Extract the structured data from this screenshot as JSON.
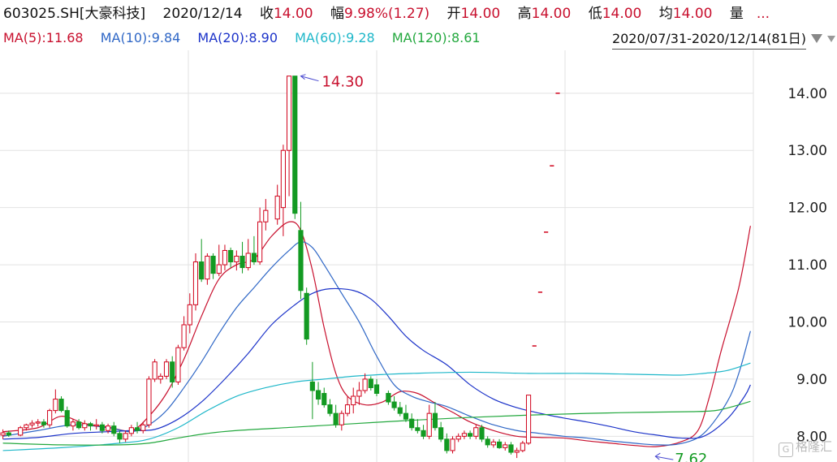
{
  "header": {
    "code_name": "603025.SH[大豪科技]",
    "date": "2020/12/14",
    "close_label": "收",
    "close_value": "14.00",
    "change_label": "幅",
    "change_value": "9.98%(1.27)",
    "open_label": "开",
    "open_value": "14.00",
    "high_label": "高",
    "high_value": "14.00",
    "low_label": "低",
    "low_value": "14.00",
    "avg_label": "均",
    "avg_value": "14.00",
    "volume_label": "量",
    "volume_value": "..."
  },
  "ma_legend": [
    {
      "label": "MA(5):11.68",
      "color": "#c8102e"
    },
    {
      "label": "MA(10):9.84",
      "color": "#2f67c6"
    },
    {
      "label": "MA(20):8.90",
      "color": "#1c33c9"
    },
    {
      "label": "MA(60):9.28",
      "color": "#1eb7c9"
    },
    {
      "label": "MA(120):8.61",
      "color": "#23a83e"
    }
  ],
  "range_text": "2020/07/31-2020/12/14(81日)",
  "watermark": "格隆汇",
  "watermark_glyph": "G",
  "colors": {
    "up": "#d0021b",
    "down": "#139a22",
    "grid": "#e2e2e2"
  },
  "chart_data": {
    "type": "candlestick",
    "title": "",
    "xlabel": "",
    "ylabel": "",
    "ylim": [
      7.55,
      14.75
    ],
    "yticks": [
      8.0,
      9.0,
      10.0,
      11.0,
      12.0,
      13.0,
      14.0
    ],
    "ytick_labels": [
      "8.00",
      "9.00",
      "10.00",
      "11.00",
      "12.00",
      "13.00",
      "14.00"
    ],
    "x_range": "2020/07/31-2020/12/14",
    "bar_count": 81,
    "annotations": [
      {
        "text": "14.30",
        "at_bar": 50,
        "price": 14.3
      },
      {
        "text": "7.62",
        "at_bar": 112,
        "price": 7.62
      }
    ],
    "candles": [
      [
        8.02,
        8.12,
        7.95,
        8.06
      ],
      [
        8.06,
        8.1,
        7.99,
        8.02
      ],
      [
        8.02,
        8.18,
        8.0,
        8.15
      ],
      [
        8.15,
        8.22,
        8.1,
        8.2
      ],
      [
        8.2,
        8.28,
        8.15,
        8.23
      ],
      [
        8.23,
        8.3,
        8.17,
        8.25
      ],
      [
        8.25,
        8.3,
        8.15,
        8.2
      ],
      [
        8.2,
        8.48,
        8.15,
        8.45
      ],
      [
        8.45,
        8.82,
        8.4,
        8.65
      ],
      [
        8.65,
        8.7,
        8.42,
        8.45
      ],
      [
        8.45,
        8.52,
        8.15,
        8.18
      ],
      [
        8.18,
        8.3,
        8.1,
        8.25
      ],
      [
        8.25,
        8.3,
        8.12,
        8.15
      ],
      [
        8.15,
        8.28,
        8.1,
        8.22
      ],
      [
        8.22,
        8.25,
        8.1,
        8.18
      ],
      [
        8.18,
        8.3,
        8.12,
        8.2
      ],
      [
        8.2,
        8.25,
        8.05,
        8.1
      ],
      [
        8.1,
        8.22,
        8.05,
        8.18
      ],
      [
        8.18,
        8.25,
        8.0,
        8.05
      ],
      [
        8.05,
        8.1,
        7.88,
        7.95
      ],
      [
        7.95,
        8.1,
        7.9,
        8.05
      ],
      [
        8.05,
        8.2,
        8.0,
        8.15
      ],
      [
        8.15,
        8.25,
        8.05,
        8.1
      ],
      [
        8.1,
        8.25,
        8.05,
        8.2
      ],
      [
        8.2,
        9.05,
        8.15,
        9.0
      ],
      [
        9.0,
        9.35,
        8.95,
        9.3
      ],
      [
        9.0,
        9.1,
        8.92,
        9.05
      ],
      [
        9.05,
        9.35,
        9.0,
        9.3
      ],
      [
        9.3,
        9.4,
        8.85,
        8.95
      ],
      [
        8.95,
        9.6,
        8.9,
        9.55
      ],
      [
        9.55,
        10.1,
        9.5,
        9.95
      ],
      [
        9.95,
        10.5,
        9.8,
        10.3
      ],
      [
        10.3,
        11.2,
        10.2,
        11.05
      ],
      [
        11.05,
        11.45,
        10.7,
        10.75
      ],
      [
        10.75,
        11.2,
        10.65,
        11.15
      ],
      [
        11.15,
        11.2,
        10.75,
        10.85
      ],
      [
        10.85,
        11.35,
        10.8,
        11.0
      ],
      [
        11.0,
        11.35,
        10.9,
        11.25
      ],
      [
        11.25,
        11.3,
        10.95,
        11.05
      ],
      [
        11.05,
        11.25,
        10.9,
        11.15
      ],
      [
        11.15,
        11.4,
        10.85,
        10.95
      ],
      [
        10.95,
        11.45,
        10.9,
        11.2
      ],
      [
        11.2,
        11.5,
        11.0,
        11.05
      ],
      [
        11.05,
        12.0,
        11.0,
        11.75
      ],
      [
        11.75,
        12.15,
        11.6,
        11.95
      ],
      [
        11.8,
        12.4,
        11.7,
        12.2
      ],
      [
        12.0,
        13.1,
        11.5,
        13.0
      ],
      [
        13.0,
        14.3,
        12.2,
        14.3
      ],
      [
        14.3,
        14.3,
        11.8,
        11.9
      ],
      [
        11.6,
        12.1,
        10.4,
        10.55
      ],
      [
        10.5,
        10.6,
        9.6,
        9.7
      ],
      [
        8.95,
        9.3,
        8.3,
        8.8
      ],
      [
        8.8,
        8.95,
        8.55,
        8.65
      ],
      [
        8.75,
        8.85,
        8.5,
        8.55
      ],
      [
        8.55,
        8.65,
        8.35,
        8.4
      ],
      [
        8.4,
        8.55,
        8.15,
        8.2
      ],
      [
        8.2,
        8.45,
        8.1,
        8.4
      ],
      [
        8.4,
        8.7,
        8.35,
        8.55
      ],
      [
        8.55,
        8.85,
        8.4,
        8.7
      ],
      [
        8.7,
        8.95,
        8.55,
        8.8
      ],
      [
        8.8,
        9.1,
        8.75,
        9.0
      ],
      [
        9.0,
        9.05,
        8.8,
        8.85
      ],
      [
        8.9,
        9.0,
        8.7,
        8.75
      ],
      [
        8.75,
        8.8,
        8.55,
        8.6
      ],
      [
        8.6,
        8.7,
        8.45,
        8.5
      ],
      [
        8.5,
        8.6,
        8.35,
        8.4
      ],
      [
        8.4,
        8.55,
        8.25,
        8.3
      ],
      [
        8.3,
        8.4,
        8.1,
        8.15
      ],
      [
        8.15,
        8.3,
        8.05,
        8.1
      ],
      [
        8.1,
        8.2,
        7.95,
        8.0
      ],
      [
        8.0,
        8.55,
        7.95,
        8.4
      ],
      [
        8.4,
        8.6,
        8.1,
        8.15
      ],
      [
        8.15,
        8.25,
        7.9,
        7.95
      ],
      [
        7.95,
        8.05,
        7.7,
        7.75
      ],
      [
        7.75,
        8.0,
        7.7,
        7.95
      ],
      [
        7.95,
        8.05,
        7.9,
        8.0
      ],
      [
        8.0,
        8.1,
        7.95,
        8.05
      ],
      [
        8.05,
        8.1,
        7.95,
        8.0
      ],
      [
        8.0,
        8.2,
        7.95,
        8.15
      ],
      [
        8.15,
        8.2,
        7.9,
        7.95
      ],
      [
        7.95,
        8.0,
        7.8,
        7.85
      ],
      [
        7.85,
        7.95,
        7.8,
        7.9
      ],
      [
        7.9,
        7.95,
        7.78,
        7.8
      ],
      [
        7.8,
        7.9,
        7.75,
        7.85
      ],
      [
        7.85,
        7.9,
        7.68,
        7.72
      ],
      [
        7.72,
        7.8,
        7.62,
        7.75
      ],
      [
        7.75,
        7.92,
        7.72,
        7.88
      ],
      [
        7.88,
        8.72,
        7.85,
        8.72
      ],
      [
        9.58,
        9.58,
        9.58,
        9.58
      ],
      [
        10.52,
        10.52,
        10.52,
        10.52
      ],
      [
        11.57,
        11.57,
        11.57,
        11.57
      ],
      [
        12.73,
        12.73,
        12.73,
        12.73
      ],
      [
        14.0,
        14.0,
        14.0,
        14.0
      ]
    ],
    "candle_slots": [
      0,
      1,
      3,
      4,
      5,
      6,
      7,
      8,
      9,
      10,
      11,
      12,
      13,
      14,
      15,
      16,
      17,
      18,
      19,
      20,
      21,
      22,
      23,
      24,
      25,
      26,
      27,
      28,
      29,
      30,
      31,
      32,
      33,
      34,
      35,
      36,
      37,
      38,
      39,
      40,
      41,
      42,
      43,
      44,
      45,
      47,
      48,
      49,
      50,
      51,
      52,
      53,
      54,
      55,
      56,
      57,
      58,
      59,
      60,
      61,
      62,
      63,
      64,
      66,
      67,
      68,
      69,
      70,
      71,
      72,
      73,
      74,
      75,
      76,
      77,
      78,
      79,
      80,
      81,
      82,
      83,
      84,
      85,
      86,
      87,
      88,
      89,
      90,
      91,
      92,
      93,
      94,
      95,
      96,
      97,
      98,
      99,
      100,
      101,
      102,
      103,
      104,
      105,
      106,
      107,
      108,
      109,
      110,
      111,
      112,
      113,
      114,
      115,
      116,
      117,
      118
    ],
    "series": [
      {
        "name": "MA(5)",
        "color": "#c8102e",
        "points": [
          [
            0,
            8.08
          ],
          [
            6,
            8.15
          ],
          [
            10,
            8.35
          ],
          [
            14,
            8.22
          ],
          [
            18,
            8.16
          ],
          [
            22,
            8.1
          ],
          [
            25,
            8.35
          ],
          [
            28,
            8.75
          ],
          [
            31,
            9.35
          ],
          [
            34,
            10.1
          ],
          [
            37,
            10.75
          ],
          [
            40,
            11.0
          ],
          [
            43,
            11.1
          ],
          [
            46,
            11.5
          ],
          [
            49,
            11.75
          ],
          [
            51,
            11.6
          ],
          [
            53,
            10.9
          ],
          [
            55,
            9.9
          ],
          [
            57,
            9.1
          ],
          [
            59,
            8.7
          ],
          [
            62,
            8.55
          ],
          [
            65,
            8.6
          ],
          [
            68,
            8.78
          ],
          [
            71,
            8.75
          ],
          [
            74,
            8.58
          ],
          [
            77,
            8.42
          ],
          [
            80,
            8.25
          ],
          [
            84,
            8.1
          ],
          [
            88,
            8.0
          ],
          [
            92,
            7.98
          ],
          [
            96,
            7.97
          ],
          [
            100,
            7.92
          ],
          [
            104,
            7.88
          ],
          [
            108,
            7.84
          ],
          [
            112,
            7.82
          ],
          [
            116,
            7.9
          ],
          [
            119,
            8.1
          ],
          [
            121,
            8.7
          ],
          [
            123,
            9.5
          ],
          [
            126,
            10.6
          ],
          [
            128,
            11.68
          ]
        ]
      },
      {
        "name": "MA(10)",
        "color": "#2f67c6",
        "points": [
          [
            0,
            8.0
          ],
          [
            6,
            8.1
          ],
          [
            12,
            8.2
          ],
          [
            18,
            8.15
          ],
          [
            22,
            8.08
          ],
          [
            25,
            8.2
          ],
          [
            28,
            8.45
          ],
          [
            31,
            8.85
          ],
          [
            34,
            9.3
          ],
          [
            37,
            9.8
          ],
          [
            40,
            10.25
          ],
          [
            43,
            10.6
          ],
          [
            46,
            10.95
          ],
          [
            49,
            11.25
          ],
          [
            51,
            11.4
          ],
          [
            53,
            11.3
          ],
          [
            55,
            11.0
          ],
          [
            58,
            10.5
          ],
          [
            61,
            10.0
          ],
          [
            64,
            9.4
          ],
          [
            67,
            8.9
          ],
          [
            70,
            8.7
          ],
          [
            73,
            8.6
          ],
          [
            76,
            8.52
          ],
          [
            80,
            8.35
          ],
          [
            84,
            8.2
          ],
          [
            88,
            8.1
          ],
          [
            92,
            8.05
          ],
          [
            96,
            8.0
          ],
          [
            100,
            7.97
          ],
          [
            104,
            7.92
          ],
          [
            108,
            7.88
          ],
          [
            112,
            7.85
          ],
          [
            116,
            7.87
          ],
          [
            120,
            8.05
          ],
          [
            124,
            8.6
          ],
          [
            126,
            9.1
          ],
          [
            128,
            9.84
          ]
        ]
      },
      {
        "name": "MA(20)",
        "color": "#1c33c9",
        "points": [
          [
            0,
            7.95
          ],
          [
            6,
            7.98
          ],
          [
            12,
            8.05
          ],
          [
            18,
            8.08
          ],
          [
            22,
            8.1
          ],
          [
            26,
            8.12
          ],
          [
            30,
            8.3
          ],
          [
            34,
            8.6
          ],
          [
            38,
            9.0
          ],
          [
            42,
            9.45
          ],
          [
            46,
            9.95
          ],
          [
            50,
            10.3
          ],
          [
            53,
            10.5
          ],
          [
            56,
            10.58
          ],
          [
            60,
            10.55
          ],
          [
            63,
            10.4
          ],
          [
            66,
            10.1
          ],
          [
            69,
            9.75
          ],
          [
            72,
            9.5
          ],
          [
            76,
            9.25
          ],
          [
            80,
            8.9
          ],
          [
            84,
            8.65
          ],
          [
            88,
            8.5
          ],
          [
            92,
            8.4
          ],
          [
            96,
            8.32
          ],
          [
            100,
            8.25
          ],
          [
            104,
            8.17
          ],
          [
            108,
            8.08
          ],
          [
            112,
            8.02
          ],
          [
            116,
            7.97
          ],
          [
            120,
            8.0
          ],
          [
            124,
            8.3
          ],
          [
            127,
            8.7
          ],
          [
            128,
            8.9
          ]
        ]
      },
      {
        "name": "MA(60)",
        "color": "#1eb7c9",
        "points": [
          [
            0,
            7.75
          ],
          [
            10,
            7.8
          ],
          [
            20,
            7.88
          ],
          [
            25,
            7.95
          ],
          [
            30,
            8.15
          ],
          [
            35,
            8.45
          ],
          [
            40,
            8.7
          ],
          [
            45,
            8.85
          ],
          [
            50,
            8.95
          ],
          [
            55,
            9.0
          ],
          [
            60,
            9.05
          ],
          [
            65,
            9.08
          ],
          [
            70,
            9.1
          ],
          [
            80,
            9.12
          ],
          [
            90,
            9.1
          ],
          [
            100,
            9.1
          ],
          [
            110,
            9.08
          ],
          [
            116,
            9.07
          ],
          [
            120,
            9.1
          ],
          [
            124,
            9.15
          ],
          [
            128,
            9.28
          ]
        ]
      },
      {
        "name": "MA(120)",
        "color": "#23a83e",
        "points": [
          [
            0,
            7.88
          ],
          [
            10,
            7.85
          ],
          [
            20,
            7.85
          ],
          [
            25,
            7.88
          ],
          [
            30,
            7.97
          ],
          [
            35,
            8.05
          ],
          [
            40,
            8.1
          ],
          [
            50,
            8.16
          ],
          [
            60,
            8.22
          ],
          [
            70,
            8.28
          ],
          [
            80,
            8.33
          ],
          [
            90,
            8.37
          ],
          [
            100,
            8.4
          ],
          [
            110,
            8.42
          ],
          [
            118,
            8.43
          ],
          [
            122,
            8.45
          ],
          [
            125,
            8.52
          ],
          [
            128,
            8.61
          ]
        ]
      }
    ]
  }
}
